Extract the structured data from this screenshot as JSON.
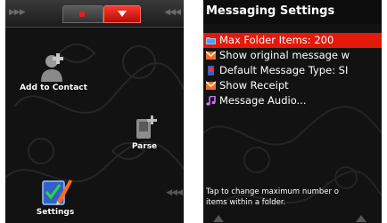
{
  "left_screen": {
    "apps": [
      {
        "label": "Add to Contact",
        "icon": "add-contact-icon"
      },
      {
        "label": "Parse",
        "icon": "parse-icon"
      },
      {
        "label": "Settings",
        "icon": "settings-icon"
      }
    ],
    "active_tab_color": "#e2190b"
  },
  "right_screen": {
    "title": "Messaging Settings",
    "items": [
      {
        "label": "Max Folder Items: 200",
        "icon": "folder-icon",
        "selected": true
      },
      {
        "label": "Show original message w",
        "icon": "envelope-icon",
        "selected": false
      },
      {
        "label": "Default Message Type: SI",
        "icon": "phone-icon",
        "selected": false
      },
      {
        "label": "Show Receipt",
        "icon": "envelope-icon",
        "selected": false
      },
      {
        "label": "Message Audio...",
        "icon": "music-note-icon",
        "selected": false
      }
    ],
    "help_line1": "Tap to change maximum number o",
    "help_line2": "items within a folder.",
    "highlight_color": "#e2190b"
  }
}
